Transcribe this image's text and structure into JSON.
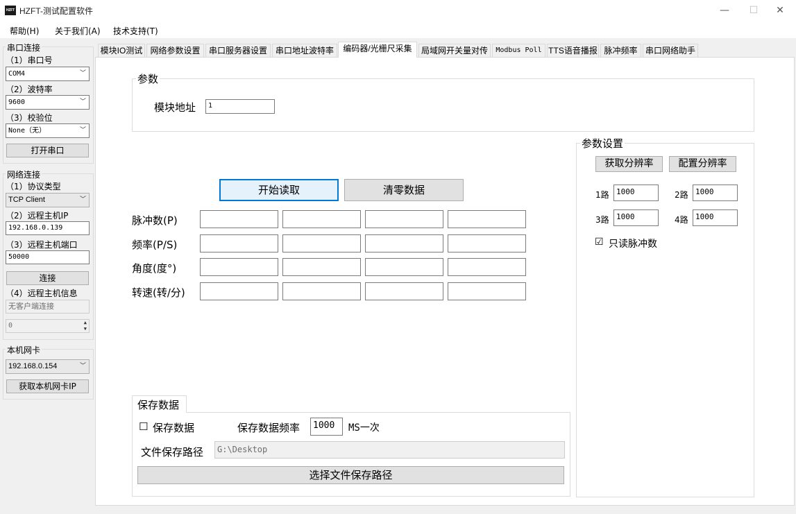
{
  "window": {
    "logo_text": "HZFT",
    "title": "HZFT-测试配置软件",
    "minimize": "—",
    "maximize": "☐",
    "close": "✕"
  },
  "menu": [
    "帮助(H)",
    "关于我们(A)",
    "技术支持(T)"
  ],
  "serial": {
    "title": "串口连接",
    "port_label": "（1）串口号",
    "port_value": "COM4",
    "baud_label": "（2）波特率",
    "baud_value": "9600",
    "parity_label": "（3）校验位",
    "parity_value": "None（无）",
    "open_button": "打开串口"
  },
  "network": {
    "title": "网络连接",
    "protocol_label": "（1）协议类型",
    "protocol_value": "TCP Client",
    "ip_label": "（2）远程主机IP",
    "ip_value": "192.168.0.139",
    "port_label": "（3）远程主机端口",
    "port_value": "50000",
    "connect_button": "连接",
    "info_label": "（4）远程主机信息",
    "info_value": "无客户端连接",
    "spinner_value": "0"
  },
  "nic": {
    "title": "本机网卡",
    "value": "192.168.0.154",
    "button": "获取本机网卡IP"
  },
  "tabs": [
    "模块IO测试",
    "网络参数设置",
    "串口服务器设置",
    "串口地址波特率",
    "编码器/光栅尺采集",
    "局域网开关量对传",
    "Modbus Poll",
    "TTS语音播报",
    "脉冲频率",
    "串口网络助手"
  ],
  "active_tab": 4,
  "params": {
    "title": "参数",
    "address_label": "模块地址",
    "address_value": "1"
  },
  "actions": {
    "start": "开始读取",
    "clear": "清零数据"
  },
  "rows": [
    {
      "label": "脉冲数(P)"
    },
    {
      "label": "频率(P/S)"
    },
    {
      "label": "角度(度°)"
    },
    {
      "label": "转速(转/分)"
    }
  ],
  "settings": {
    "title": "参数设置",
    "get_button": "获取分辨率",
    "set_button": "配置分辨率",
    "ch1_label": "1路",
    "ch1_value": "1000",
    "ch2_label": "2路",
    "ch2_value": "1000",
    "ch3_label": "3路",
    "ch3_value": "1000",
    "ch4_label": "4路",
    "ch4_value": "1000",
    "readonly_check": "☑",
    "readonly_label": "只读脉冲数"
  },
  "save": {
    "title": "保存数据",
    "check": "☐",
    "check_label": "保存数据",
    "freq_label": "保存数据频率",
    "freq_value": "1000",
    "freq_unit": "MS一次",
    "path_label": "文件保存路径",
    "path_value": "G:\\Desktop",
    "path_button": "选择文件保存路径"
  }
}
